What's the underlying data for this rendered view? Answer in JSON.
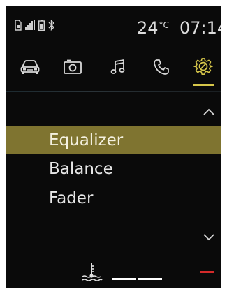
{
  "status": {
    "temperature": "24",
    "temperature_unit": "°C",
    "time": "07:14",
    "icons": [
      "sim-card-icon",
      "signal-bars-icon",
      "battery-icon",
      "bluetooth-icon"
    ]
  },
  "tabs": [
    {
      "icon": "car-icon",
      "active": false
    },
    {
      "icon": "media-icon",
      "active": false
    },
    {
      "icon": "music-note-icon",
      "active": false
    },
    {
      "icon": "phone-icon",
      "active": false
    },
    {
      "icon": "settings-gear-icon",
      "active": true
    }
  ],
  "menu": {
    "items": [
      {
        "label": "Equalizer",
        "selected": true
      },
      {
        "label": "Balance",
        "selected": false
      },
      {
        "label": "Fader",
        "selected": false
      }
    ],
    "scroll_up_icon": "chevron-up-icon",
    "scroll_down_icon": "chevron-down-icon"
  },
  "bottom_bar": {
    "icon": "coolant-temperature-icon",
    "gauge_segments": [
      {
        "state": "filled",
        "color": "#ffffff"
      },
      {
        "state": "filled",
        "color": "#ffffff"
      },
      {
        "state": "empty",
        "color": "#555555"
      },
      {
        "state": "warning",
        "color": "#d42a2a"
      }
    ]
  },
  "colors": {
    "accent": "#d6c64a",
    "selected_row": "#7f7430",
    "background": "#0a0a0a",
    "warning": "#d42a2a"
  }
}
